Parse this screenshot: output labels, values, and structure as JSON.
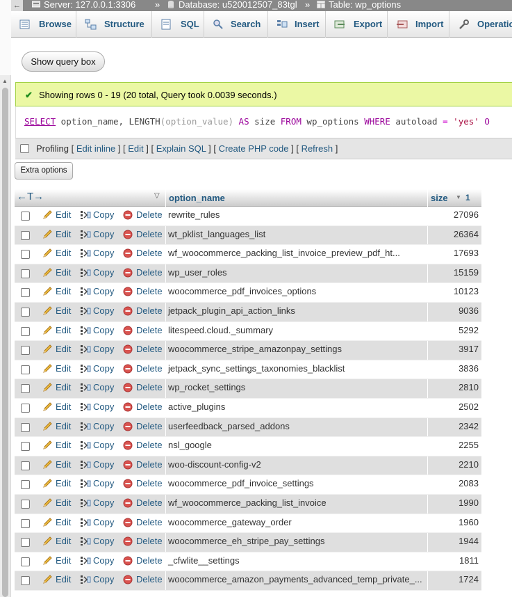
{
  "breadcrumb": {
    "back": "←",
    "server": "Server: 127.0.0.1:3306",
    "database": "Database: u520012507_83tgl",
    "table": "Table: wp_options",
    "separator": "»"
  },
  "tabs": [
    {
      "label": "Browse",
      "icon": "browse-icon"
    },
    {
      "label": "Structure",
      "icon": "structure-icon"
    },
    {
      "label": "SQL",
      "icon": "sql-icon"
    },
    {
      "label": "Search",
      "icon": "search-icon"
    },
    {
      "label": "Insert",
      "icon": "insert-icon"
    },
    {
      "label": "Export",
      "icon": "export-icon"
    },
    {
      "label": "Import",
      "icon": "import-icon"
    },
    {
      "label": "Operatio",
      "icon": "wrench-icon"
    }
  ],
  "show_query_box": "Show query box",
  "success_message": "Showing rows 0 - 19 (20 total, Query took 0.0039 seconds.)",
  "sql": {
    "select": "SELECT",
    "col1": " option_name, ",
    "fn": "LENGTH",
    "arg": "(option_value)",
    "as": " AS ",
    "alias": "size ",
    "from": "FROM",
    "table": " wp_options ",
    "where": "WHERE",
    "cond": " autoload ",
    "eq": "=",
    "val": " 'yes'",
    "tail": " O"
  },
  "profiling": {
    "label": "Profiling",
    "links": [
      "Edit inline",
      "Edit",
      "Explain SQL",
      "Create PHP code",
      "Refresh"
    ]
  },
  "extra_options": "Extra options",
  "table": {
    "col_name": "option_name",
    "col_size": "size",
    "sort_order": "1",
    "action_edit": "Edit",
    "action_copy": "Copy",
    "action_delete": "Delete",
    "rows": [
      {
        "name": "rewrite_rules",
        "size": "27096"
      },
      {
        "name": "wt_pklist_languages_list",
        "size": "26364"
      },
      {
        "name": "wf_woocommerce_packing_list_invoice_preview_pdf_ht...",
        "size": "17693"
      },
      {
        "name": "wp_user_roles",
        "size": "15159"
      },
      {
        "name": "woocommerce_pdf_invoices_options",
        "size": "10123"
      },
      {
        "name": "jetpack_plugin_api_action_links",
        "size": "9036"
      },
      {
        "name": "litespeed.cloud._summary",
        "size": "5292"
      },
      {
        "name": "woocommerce_stripe_amazonpay_settings",
        "size": "3917"
      },
      {
        "name": "jetpack_sync_settings_taxonomies_blacklist",
        "size": "3836"
      },
      {
        "name": "wp_rocket_settings",
        "size": "2810"
      },
      {
        "name": "active_plugins",
        "size": "2502"
      },
      {
        "name": "userfeedback_parsed_addons",
        "size": "2342"
      },
      {
        "name": "nsl_google",
        "size": "2255"
      },
      {
        "name": "woo-discount-config-v2",
        "size": "2210"
      },
      {
        "name": "woocommerce_pdf_invoice_settings",
        "size": "2083"
      },
      {
        "name": "wf_woocommerce_packing_list_invoice",
        "size": "1990"
      },
      {
        "name": "woocommerce_gateway_order",
        "size": "1960"
      },
      {
        "name": "woocommerce_eh_stripe_pay_settings",
        "size": "1944"
      },
      {
        "name": "_cfwlite__settings",
        "size": "1811"
      },
      {
        "name": "woocommerce_amazon_payments_advanced_temp_private_...",
        "size": "1724"
      }
    ]
  },
  "colors": {
    "link": "#235a81",
    "success_bg": "#ebf8a4",
    "row_alt": "#dfdfdf"
  }
}
